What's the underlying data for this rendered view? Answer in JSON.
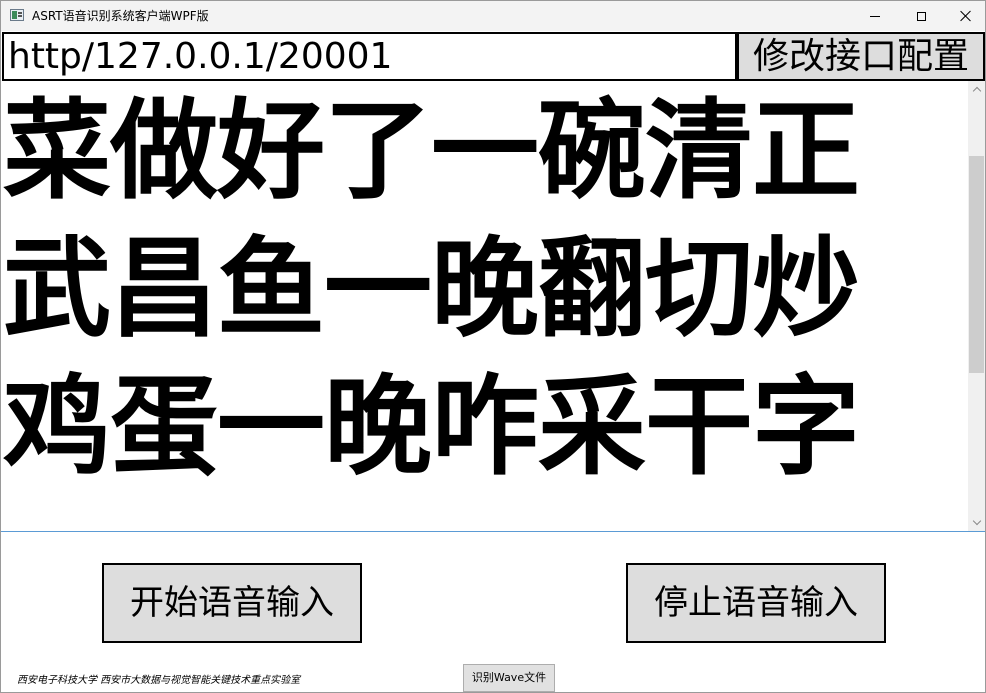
{
  "window": {
    "title": "ASRT语音识别系统客户端WPF版",
    "icon": "app-window-icon",
    "controls": {
      "minimize": "minimize-icon",
      "maximize": "maximize-icon",
      "close": "close-icon"
    }
  },
  "api": {
    "url": "http/127.0.0.1/20001",
    "config_button_label": "修改接口配置"
  },
  "result": {
    "text": "菜做好了一碗清正武昌鱼一晚翻切炒鸡蛋一晚咋采干字"
  },
  "controls": {
    "start_label": "开始语音输入",
    "stop_label": "停止语音输入",
    "wave_label": "识别Wave文件"
  },
  "footer": {
    "credits": "西安电子科技大学  西安市大数据与视觉智能关键技术重点实验室"
  },
  "colors": {
    "titlebar_bg": "#f3f3f3",
    "button_bg": "#dddddd",
    "focus_border": "#5b9bd5",
    "scroll_thumb": "#cdcdcd"
  }
}
